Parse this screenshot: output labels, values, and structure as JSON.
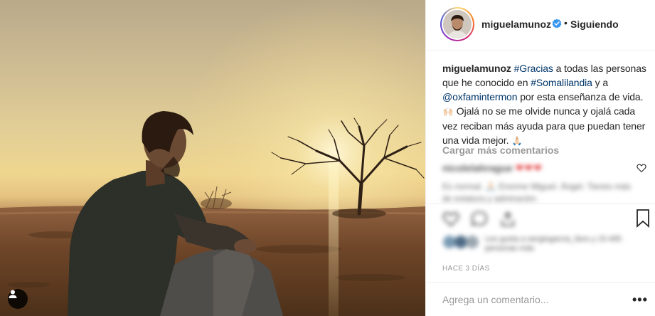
{
  "post": {
    "photo_alt": "",
    "user_tag_icon": "user-tag-icon"
  },
  "header": {
    "username": "miguelamunoz",
    "separator": "•",
    "follow_status": "Siguiendo",
    "verified_icon": "verified-badge-icon"
  },
  "caption": {
    "username": "miguelamunoz",
    "hashtag_gracias": "#Gracias",
    "text_1": " a todas las personas que he conocido en ",
    "hashtag_somalilandia": "#Somalilandia",
    "text_2": " y a ",
    "mention": "@oxfamintermon",
    "text_3": " por esta enseñanza de vida. ",
    "emoji_1": "🙌🏻",
    "text_4": " Ojalá no se me olvide nunca y ojalá cada vez reciban más ayuda para que puedan tener una vida mejor. ",
    "emoji_2": "🙏🏻"
  },
  "comments": {
    "load_more": "Cargar más comentarios",
    "comment_1_user": "nicolelahrague",
    "comment_1_text": "❤❤❤",
    "comment_2_text": "Es normal. 🙏🏻 Enorme Miguel. Ángel. Tienes más de estatura y admiración."
  },
  "likes": {
    "text": "Les gusta a sergiogarcia_fans y 15.495 personas más"
  },
  "timestamp": "HACE 3 DÍAS",
  "comment_box": {
    "placeholder": "Agrega un comentario...",
    "more": "•••"
  },
  "colors": {
    "link": "#003569",
    "muted": "#999999",
    "heart": "#e03434",
    "verified": "#3897f0"
  }
}
